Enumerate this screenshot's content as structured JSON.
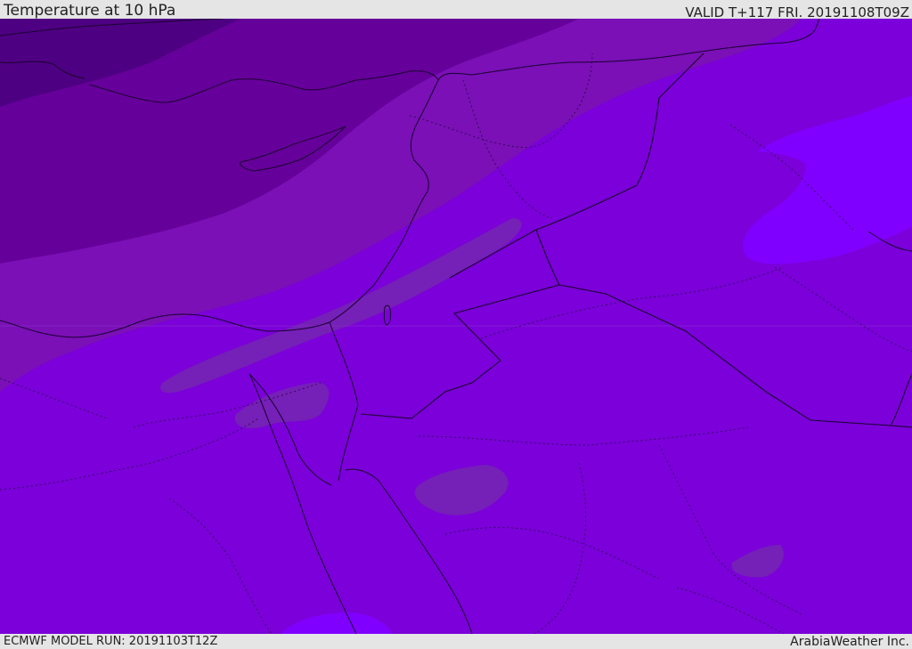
{
  "header": {
    "title": "Temperature at 10 hPa",
    "valid": "VALID T+117 FRI. 20191108T09Z"
  },
  "footer": {
    "model_run": "ECMWF MODEL RUN: 20191103T12Z",
    "credit": "ArabiaWeather Inc."
  },
  "colors": {
    "band_darkest": "#4e0082",
    "band_dark": "#66009a",
    "band_mid": "#7a10b6",
    "band_base": "#7b00d9",
    "patch_muted": "#7520b6",
    "patch_bright": "#8000ff",
    "coastline": "#1a0030",
    "bar_background": "#e5e5e5"
  }
}
